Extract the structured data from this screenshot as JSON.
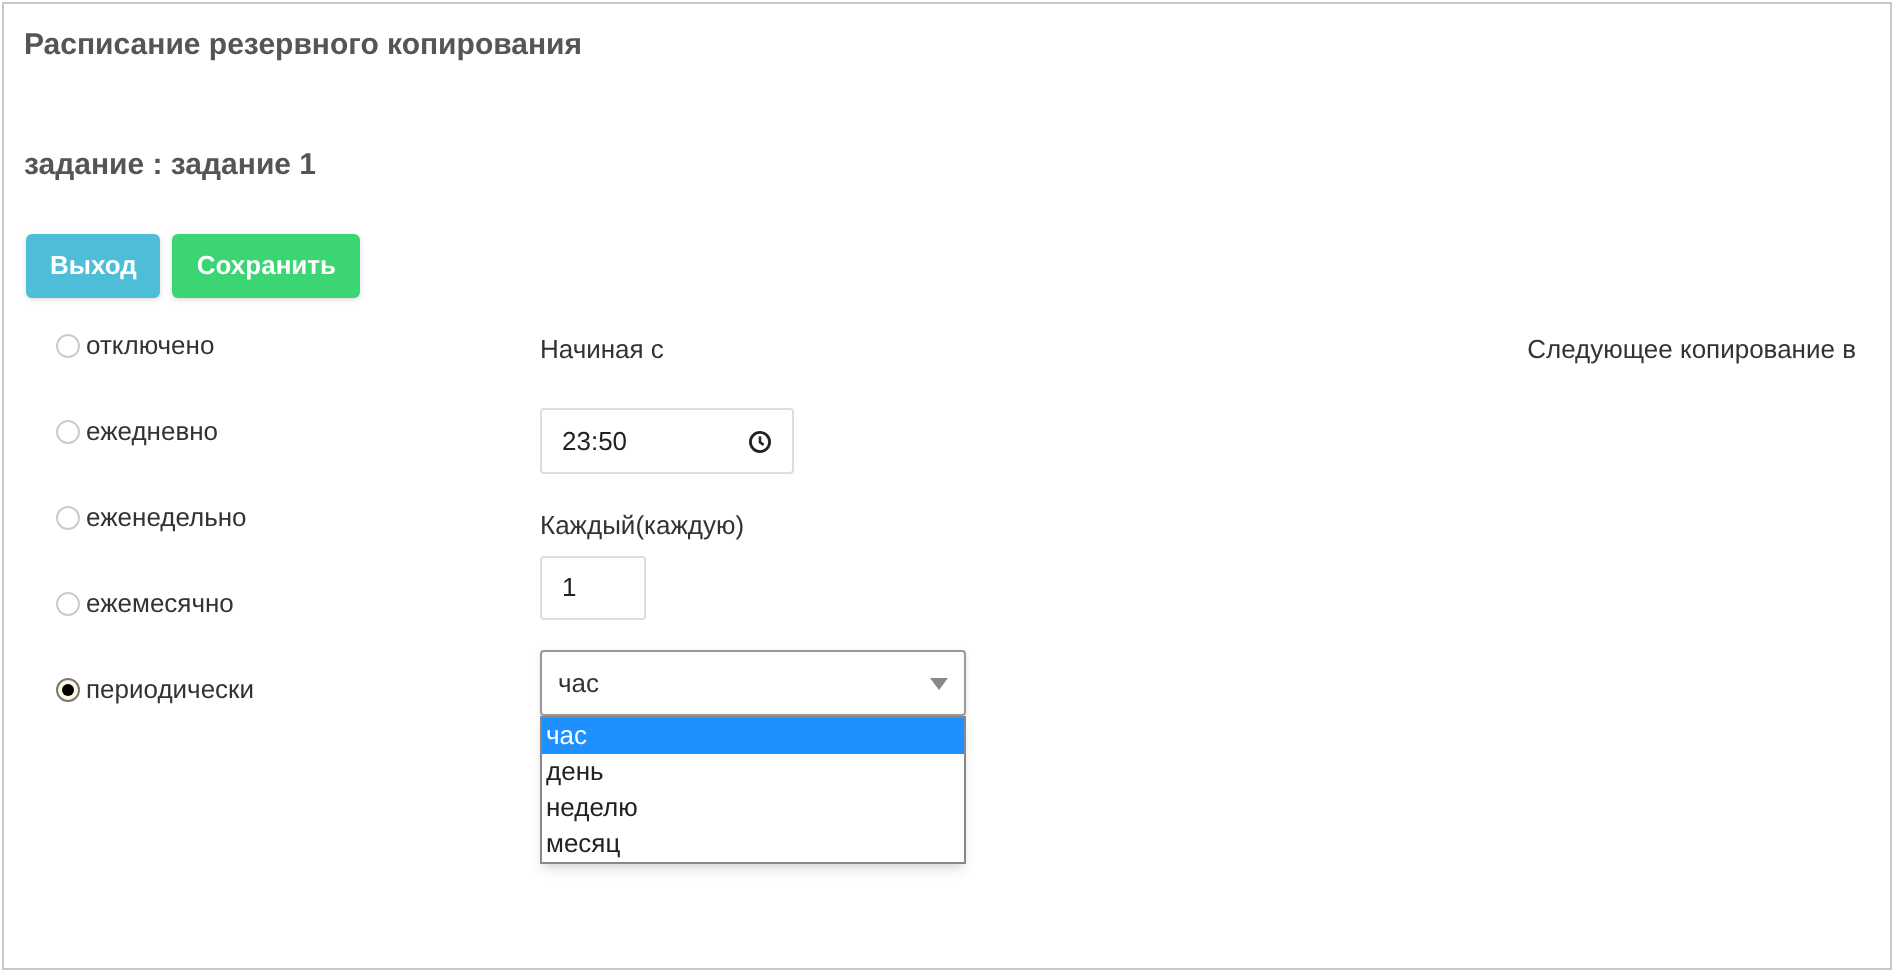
{
  "title": "Расписание резервного копирования",
  "job": {
    "label": "задание : задание 1"
  },
  "buttons": [
    {
      "label": "Выход",
      "kind": "exit"
    },
    {
      "label": "Сохранить",
      "kind": "save"
    }
  ],
  "schedule_options": [
    {
      "label": "отключено",
      "selected": false
    },
    {
      "label": "ежедневно",
      "selected": false
    },
    {
      "label": "еженедельно",
      "selected": false
    },
    {
      "label": "ежемесячно",
      "selected": false
    },
    {
      "label": "периодически",
      "selected": true
    }
  ],
  "start": {
    "label": "Начиная с",
    "value": "23:50"
  },
  "every": {
    "label": "Каждый(каждую)",
    "value": "1"
  },
  "unit_select": {
    "value": "час",
    "expanded": true,
    "options": [
      {
        "label": "час",
        "selected": true
      },
      {
        "label": "день",
        "selected": false
      },
      {
        "label": "неделю",
        "selected": false
      },
      {
        "label": "месяц",
        "selected": false
      }
    ]
  },
  "next_backup": {
    "label": "Следующее копирование в"
  }
}
